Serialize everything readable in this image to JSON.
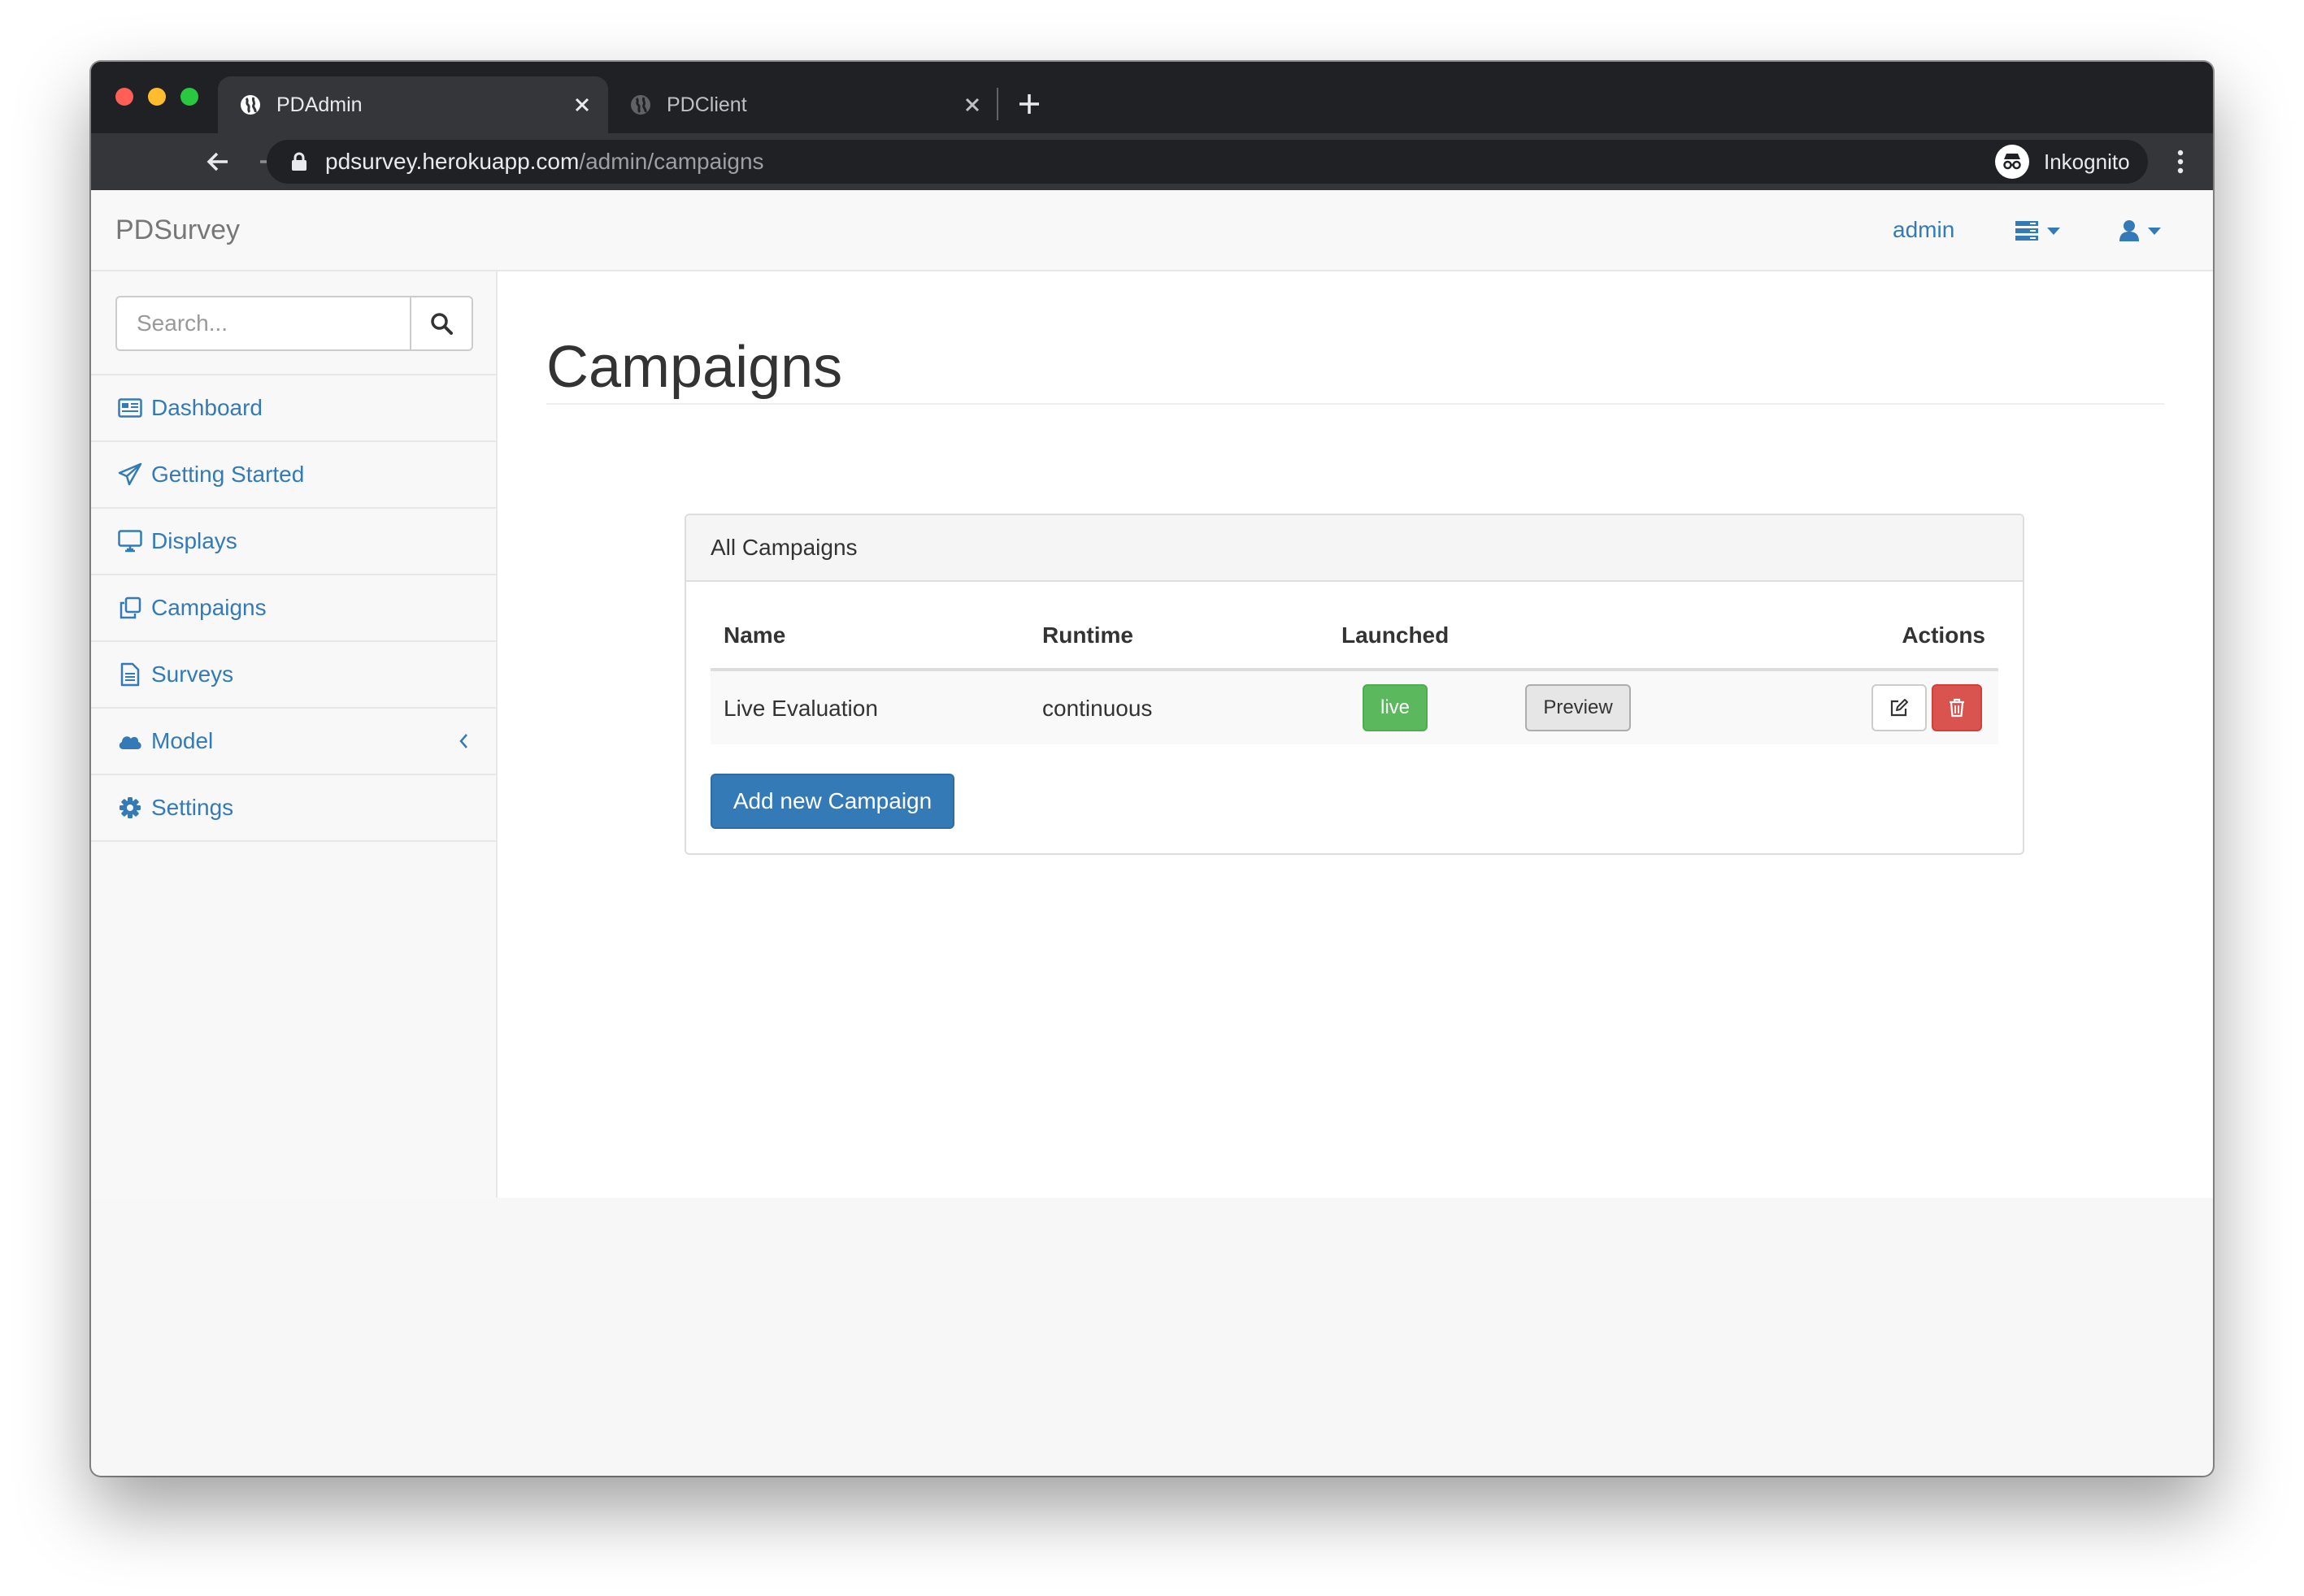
{
  "browser": {
    "tabs": [
      {
        "title": "PDAdmin",
        "active": true,
        "icon": "globe-icon"
      },
      {
        "title": "PDClient",
        "active": false,
        "icon": "globe-icon"
      }
    ],
    "url_host": "pdsurvey.herokuapp.com",
    "url_path": "/admin/campaigns",
    "profile_label": "Inkognito",
    "colors": {
      "frame": "#202124",
      "toolbar": "#35363a",
      "close": "#ff5f57",
      "minimize": "#febc2e",
      "zoom": "#28c840"
    }
  },
  "navbar": {
    "brand": "PDSurvey",
    "user_link": "admin",
    "icons": [
      "server-dropdown-icon",
      "user-dropdown-icon"
    ]
  },
  "sidebar": {
    "search_placeholder": "Search...",
    "items": [
      {
        "label": "Dashboard",
        "icon": "dashboard-icon"
      },
      {
        "label": "Getting Started",
        "icon": "paper-plane-icon"
      },
      {
        "label": "Displays",
        "icon": "desktop-icon"
      },
      {
        "label": "Campaigns",
        "icon": "clone-icon"
      },
      {
        "label": "Surveys",
        "icon": "file-text-icon"
      },
      {
        "label": "Model",
        "icon": "cloud-icon"
      },
      {
        "label": "Settings",
        "icon": "cog-icon"
      }
    ]
  },
  "main": {
    "title": "Campaigns",
    "panel_title": "All Campaigns",
    "columns": [
      "Name",
      "Runtime",
      "Launched",
      "Actions"
    ],
    "rows": [
      {
        "name": "Live Evaluation",
        "runtime": "continuous",
        "launched": "live",
        "preview": "Preview"
      }
    ],
    "add_button": "Add new Campaign",
    "colors": {
      "primary": "#337ab7",
      "success": "#5cb85c",
      "danger": "#d9534f"
    }
  }
}
